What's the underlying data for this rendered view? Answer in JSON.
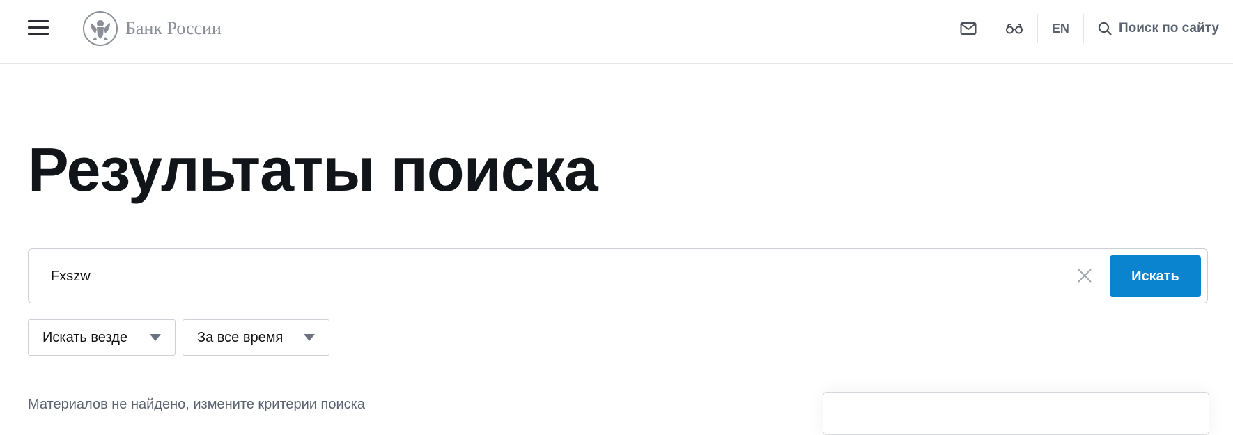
{
  "header": {
    "logo_text": "Банк России",
    "lang_label": "EN",
    "search_label": "Поиск по сайту"
  },
  "icons": {
    "menu": "hamburger-icon",
    "logo": "double-headed-eagle-emblem",
    "mail": "mail-icon",
    "glasses": "glasses-icon",
    "search": "search-icon",
    "clear": "close-icon",
    "dropdown": "caret-down-icon"
  },
  "main": {
    "title": "Результаты поиска",
    "search": {
      "value": "Fxszw",
      "button_label": "Искать"
    },
    "filters": [
      {
        "selected": "Искать везде"
      },
      {
        "selected": "За все время"
      }
    ],
    "no_results_text": "Материалов не найдено, измените критерии поиска"
  },
  "colors": {
    "accent": "#0a84cf",
    "text_dark": "#111418",
    "text_muted": "#5c6370",
    "border": "#cdd1d7"
  }
}
